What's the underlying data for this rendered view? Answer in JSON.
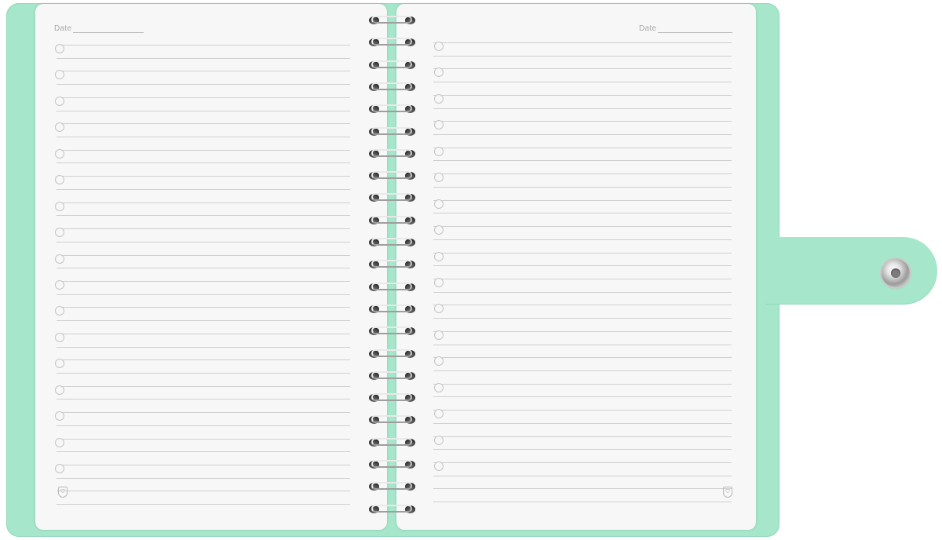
{
  "notebook": {
    "date_label_left": "Date",
    "date_label_right": "Date",
    "cover_color": "#a6e6cb",
    "page_color": "#f7f7f7",
    "line_color": "#cfcfcf",
    "clasp_icon": "snap-button-icon",
    "footer_icon": "brand-shield-icon"
  }
}
